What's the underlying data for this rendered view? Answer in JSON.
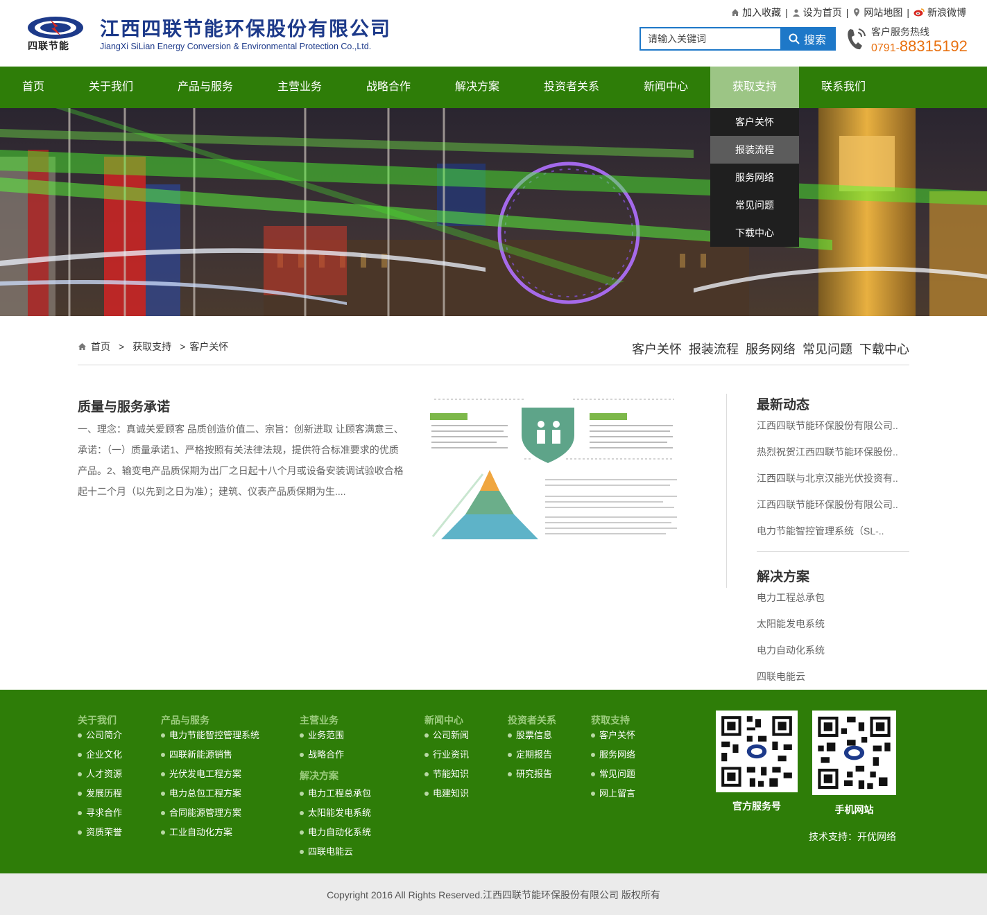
{
  "header": {
    "logo_text": "四联节能",
    "company_cn": "江西四联节能环保股份有限公司",
    "company_en": "JiangXi SiLian Energy Conversion & Environmental Protection Co.,Ltd.",
    "toplinks": [
      {
        "label": "加入收藏",
        "icon": "home-icon"
      },
      {
        "label": "设为首页",
        "icon": "user-icon"
      },
      {
        "label": "网站地图",
        "icon": "map-pin-icon"
      },
      {
        "label": "新浪微博",
        "icon": "weibo-icon"
      }
    ],
    "search": {
      "placeholder": "请输入关键词",
      "button": "搜索"
    },
    "hotline": {
      "label": "客户服务热线",
      "prefix": "0791-",
      "number": "88315192"
    }
  },
  "nav": {
    "items": [
      "首页",
      "关于我们",
      "产品与服务",
      "主营业务",
      "战略合作",
      "解决方案",
      "投资者关系",
      "新闻中心",
      "获取支持",
      "联系我们"
    ],
    "active": "获取支持",
    "dropdown": [
      "客户关怀",
      "报装流程",
      "服务网络",
      "常见问题",
      "下载中心"
    ],
    "dropdown_active": "报装流程"
  },
  "breadcrumb": {
    "items": [
      "首页",
      "获取支持",
      "客户关怀"
    ]
  },
  "subnav": [
    "客户关怀",
    "报装流程",
    "服务网络",
    "常见问题",
    "下载中心"
  ],
  "content": {
    "title": "质量与服务承诺",
    "body": "一、理念：真诚关爱顾客 品质创造价值二、宗旨：创新进取 让顾客满意三、承诺：（一）质量承诺1、严格按照有关法律法规，提供符合标准要求的优质产品。2、输变电产品质保期为出厂之日起十八个月或设备安装调试验收合格起十二个月（以先到之日为准）；建筑、仪表产品质保期为生...."
  },
  "sidebar": {
    "news_title": "最新动态",
    "news": [
      "江西四联节能环保股份有限公司..",
      "热烈祝贺江西四联节能环保股份..",
      "江西四联与北京汉能光伏投资有..",
      "江西四联节能环保股份有限公司..",
      "电力节能智控管理系统（SL-.."
    ],
    "solutions_title": "解决方案",
    "solutions": [
      "电力工程总承包",
      "太阳能发电系统",
      "电力自动化系统",
      "四联电能云"
    ]
  },
  "footer": {
    "columns": [
      {
        "title": "关于我们",
        "items": [
          "公司简介",
          "企业文化",
          "人才资源",
          "发展历程",
          "寻求合作",
          "资质荣誉"
        ]
      },
      {
        "title": "产品与服务",
        "items": [
          "电力节能智控管理系统",
          "四联新能源销售",
          "光伏发电工程方案",
          "电力总包工程方案",
          "合同能源管理方案",
          "工业自动化方案"
        ]
      },
      {
        "title": "主营业务",
        "items": [
          "业务范围",
          "战略合作"
        ],
        "title2": "解决方案",
        "items2": [
          "电力工程总承包",
          "太阳能发电系统",
          "电力自动化系统",
          "四联电能云"
        ]
      },
      {
        "title": "新闻中心",
        "items": [
          "公司新闻",
          "行业资讯",
          "节能知识",
          "电建知识"
        ]
      },
      {
        "title": "投资者关系",
        "items": [
          "股票信息",
          "定期报告",
          "研究报告"
        ]
      },
      {
        "title": "获取支持",
        "items": [
          "客户关怀",
          "服务网络",
          "常见问题",
          "网上留言"
        ]
      }
    ],
    "qr_labels": [
      "官方服务号",
      "手机网站"
    ],
    "tech_support": "技术支持：开优网络",
    "copyright": "Copyright 2016 All Rights Reserved.江西四联节能环保股份有限公司 版权所有"
  },
  "colors": {
    "nav_green": "#2e7d08",
    "nav_active": "#9cc585",
    "brand_blue": "#1d3a8a",
    "hotline_orange": "#e8700f",
    "search_blue": "#1e78c8"
  }
}
